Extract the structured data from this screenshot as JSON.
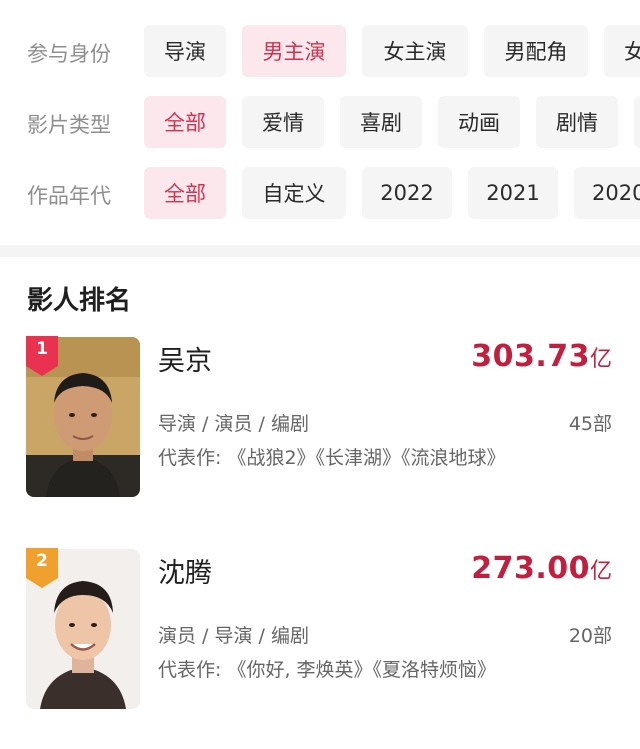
{
  "filters": {
    "role": {
      "label": "参与身份",
      "options": [
        "导演",
        "男主演",
        "女主演",
        "男配角",
        "女"
      ],
      "selected": "男主演"
    },
    "genre": {
      "label": "影片类型",
      "options": [
        "全部",
        "爱情",
        "喜剧",
        "动画",
        "剧情"
      ],
      "selected": "全部"
    },
    "year": {
      "label": "作品年代",
      "options": [
        "全部",
        "自定义",
        "2022",
        "2021",
        "2020"
      ],
      "selected": "全部"
    }
  },
  "ranking": {
    "title": "影人排名",
    "people": [
      {
        "rank": "1",
        "name": "吴京",
        "box_office": "303.73",
        "unit": "亿",
        "roles": "导演 / 演员 / 编剧",
        "works_count": "45部",
        "works": "代表作: 《战狼2》《长津湖》《流浪地球》",
        "badge_color": "#e8324f"
      },
      {
        "rank": "2",
        "name": "沈腾",
        "box_office": "273.00",
        "unit": "亿",
        "roles": "演员 / 导演 / 编剧",
        "works_count": "20部",
        "works": "代表作: 《你好, 李焕英》《夏洛特烦恼》",
        "badge_color": "#f0a02c"
      }
    ]
  },
  "colors": {
    "accent": "#c21f3f",
    "chip_active_bg": "#fce8ec",
    "chip_active_text": "#d0334f",
    "chip_bg": "#f5f5f5"
  }
}
